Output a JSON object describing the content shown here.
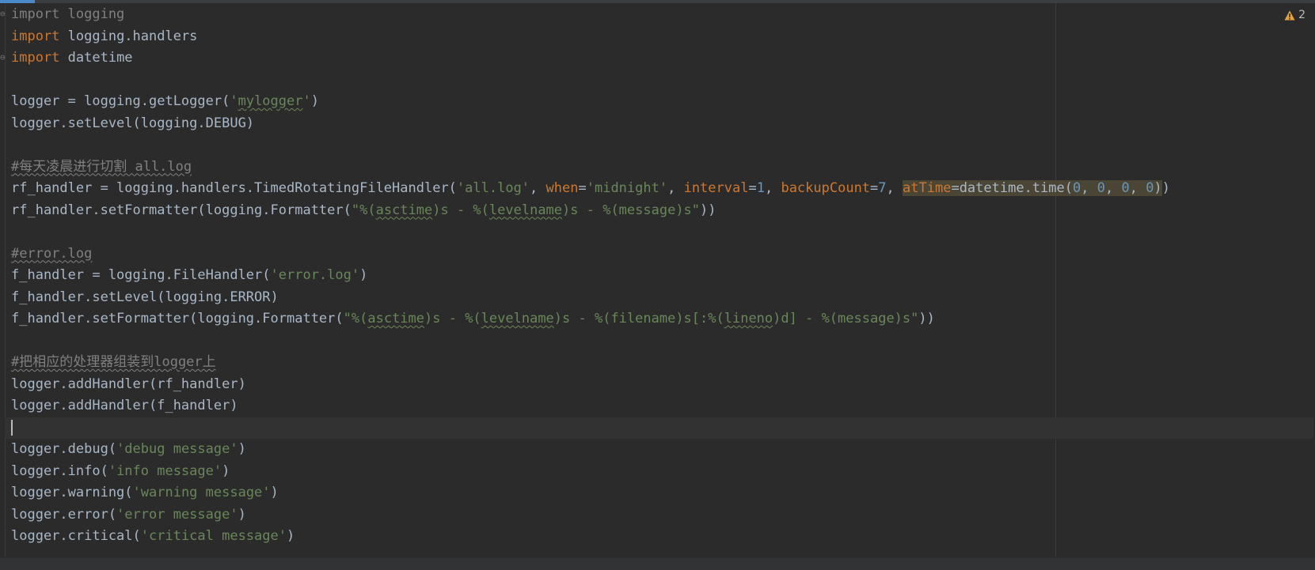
{
  "editor": {
    "language": "python",
    "warnings": {
      "count": "2",
      "icon": "warning-triangle-icon",
      "color": "#e8a33d"
    },
    "colors": {
      "background": "#2b2b2b",
      "keyword": "#cc7832",
      "string": "#6a8759",
      "number": "#6897bb",
      "comment": "#808080",
      "text": "#a9b7c6"
    },
    "lines": [
      [
        {
          "t": "import logging",
          "c": "unused"
        }
      ],
      [
        {
          "t": "import",
          "c": "kw"
        },
        {
          "t": " logging.handlers"
        }
      ],
      [
        {
          "t": "import",
          "c": "kw"
        },
        {
          "t": " datetime"
        }
      ],
      [],
      [
        {
          "t": "logger = logging.getLogger("
        },
        {
          "t": "'",
          "c": "str"
        },
        {
          "t": "mylogger",
          "c": "str typo"
        },
        {
          "t": "'",
          "c": "str"
        },
        {
          "t": ")"
        }
      ],
      [
        {
          "t": "logger.setLevel(logging.DEBUG)"
        }
      ],
      [],
      [
        {
          "t": "#每天凌晨进行切割 all.log",
          "c": "cmt typo-c"
        }
      ],
      [
        {
          "t": "rf_handler = logging.handlers.TimedRotatingFileHandler("
        },
        {
          "t": "'all.log'",
          "c": "str"
        },
        {
          "t": ", "
        },
        {
          "t": "when",
          "c": "kwarg"
        },
        {
          "t": "="
        },
        {
          "t": "'midnight'",
          "c": "str"
        },
        {
          "t": ", "
        },
        {
          "t": "interval",
          "c": "kwarg"
        },
        {
          "t": "="
        },
        {
          "t": "1",
          "c": "num"
        },
        {
          "t": ", "
        },
        {
          "t": "backupCount",
          "c": "kwarg"
        },
        {
          "t": "="
        },
        {
          "t": "7",
          "c": "num"
        },
        {
          "t": ", "
        },
        {
          "t": "atTime",
          "c": "kwarg sel"
        },
        {
          "t": "=datetime.time(",
          "c": "sel"
        },
        {
          "t": "0",
          "c": "num sel"
        },
        {
          "t": ", ",
          "c": "sel"
        },
        {
          "t": "0",
          "c": "num sel"
        },
        {
          "t": ", ",
          "c": "sel"
        },
        {
          "t": "0",
          "c": "num sel"
        },
        {
          "t": ", ",
          "c": "sel"
        },
        {
          "t": "0",
          "c": "num sel"
        },
        {
          "t": ")",
          "c": "sel"
        },
        {
          "t": ")"
        }
      ],
      [
        {
          "t": "rf_handler.setFormatter(logging.Formatter("
        },
        {
          "t": "\"%(",
          "c": "str"
        },
        {
          "t": "asctime",
          "c": "str typo"
        },
        {
          "t": ")s - %(",
          "c": "str"
        },
        {
          "t": "levelname",
          "c": "str typo"
        },
        {
          "t": ")s - %(message)s\"",
          "c": "str"
        },
        {
          "t": "))"
        }
      ],
      [],
      [
        {
          "t": "#error.log",
          "c": "cmt typo-c"
        }
      ],
      [
        {
          "t": "f_handler = logging.FileHandler("
        },
        {
          "t": "'error.log'",
          "c": "str"
        },
        {
          "t": ")"
        }
      ],
      [
        {
          "t": "f_handler.setLevel(logging.ERROR)"
        }
      ],
      [
        {
          "t": "f_handler.setFormatter(logging.Formatter("
        },
        {
          "t": "\"%(",
          "c": "str"
        },
        {
          "t": "asctime",
          "c": "str typo"
        },
        {
          "t": ")s - %(",
          "c": "str"
        },
        {
          "t": "levelname",
          "c": "str typo"
        },
        {
          "t": ")s - %(filename)s[:%(",
          "c": "str"
        },
        {
          "t": "lineno",
          "c": "str typo"
        },
        {
          "t": ")d] - %(message)s\"",
          "c": "str"
        },
        {
          "t": "))"
        }
      ],
      [],
      [
        {
          "t": "#把相应的处理器组装到logger上",
          "c": "cmt typo-c"
        }
      ],
      [
        {
          "t": "logger.addHandler(rf_handler)"
        }
      ],
      [
        {
          "t": "logger.addHandler(f_handler)"
        }
      ],
      [],
      [
        {
          "t": "logger.debug("
        },
        {
          "t": "'debug message'",
          "c": "str"
        },
        {
          "t": ")"
        }
      ],
      [
        {
          "t": "logger.info("
        },
        {
          "t": "'info message'",
          "c": "str"
        },
        {
          "t": ")"
        }
      ],
      [
        {
          "t": "logger.warning("
        },
        {
          "t": "'warning message'",
          "c": "str"
        },
        {
          "t": ")"
        }
      ],
      [
        {
          "t": "logger.error("
        },
        {
          "t": "'error message'",
          "c": "str"
        },
        {
          "t": ")"
        }
      ],
      [
        {
          "t": "logger.critical("
        },
        {
          "t": "'critical message'",
          "c": "str"
        },
        {
          "t": ")"
        }
      ]
    ]
  }
}
